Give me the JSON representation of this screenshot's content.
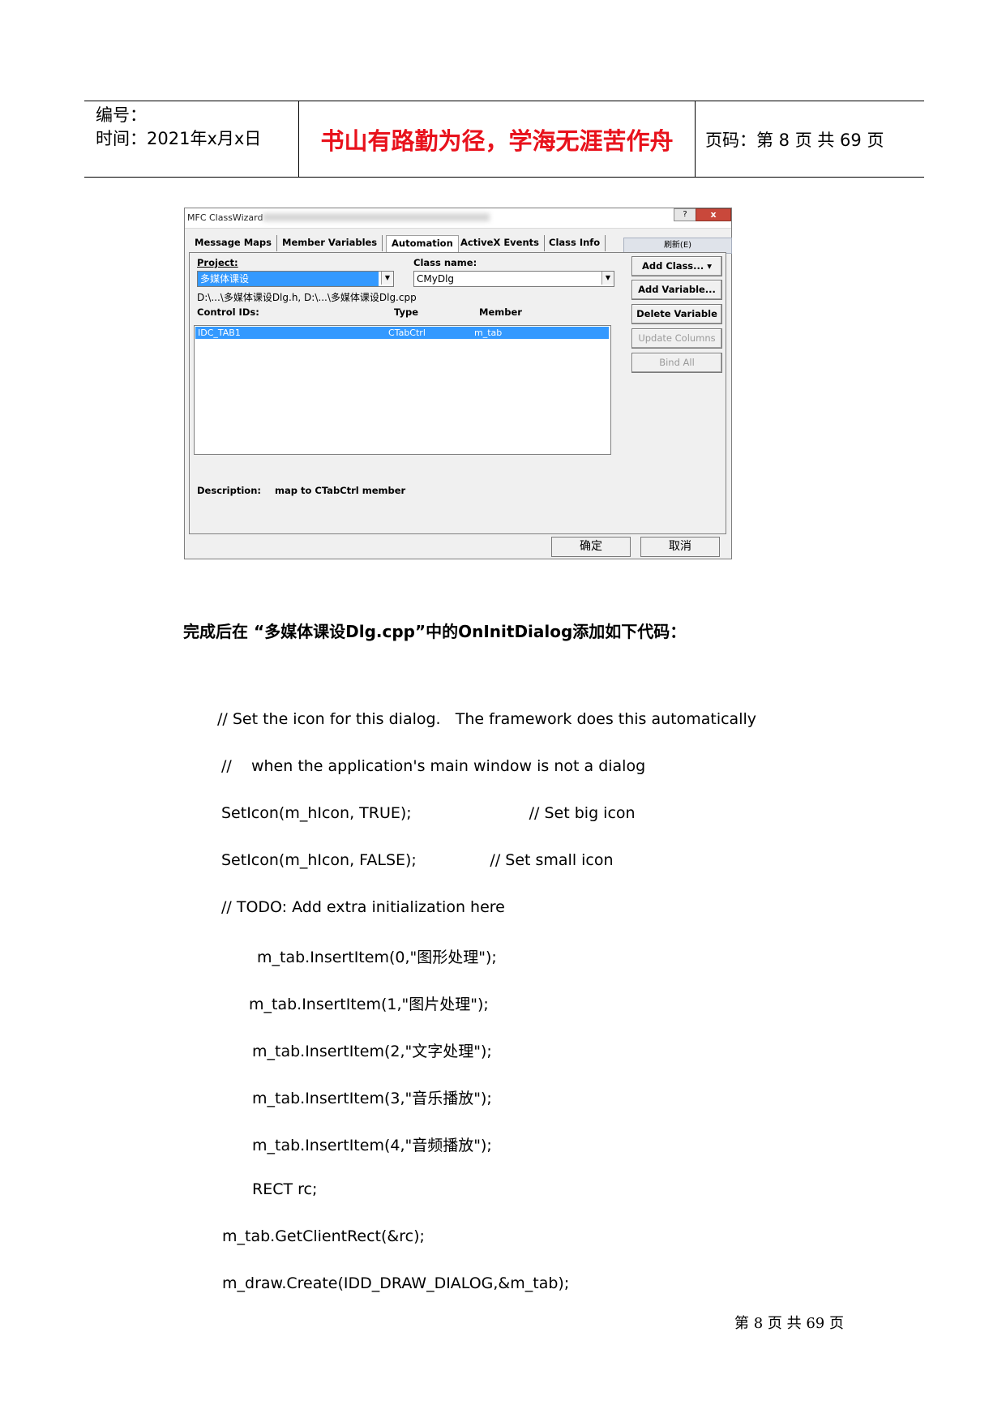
{
  "header": {
    "number_label": "编号：",
    "time_text": "时间：2021年x月x日",
    "motto": "书山有路勤为径，学海无涯苦作舟",
    "page_text": "页码：第 8 页  共 69 页"
  },
  "dialog": {
    "title": "MFC ClassWizard",
    "help_btn": "?",
    "close_btn": "x",
    "tabs": [
      "Message Maps",
      "Member Variables",
      "Automation",
      "ActiveX Events",
      "Class Info"
    ],
    "refresh_btn": "刷新(E)",
    "project_label": "Project:",
    "project_value": "多媒体课设",
    "class_label": "Class name:",
    "class_value": "CMyDlg",
    "file_path": "D:\\...\\多媒体课设Dlg.h, D:\\...\\多媒体课设Dlg.cpp",
    "col_headers": [
      "Control IDs:",
      "Type",
      "Member"
    ],
    "rows": [
      [
        "IDC_TAB1",
        "CTabCtrl",
        "m_tab"
      ]
    ],
    "buttons": [
      {
        "label": "Add Class...  ▾",
        "enabled": true
      },
      {
        "label": "Add Variable...",
        "enabled": true
      },
      {
        "label": "Delete Variable",
        "enabled": true
      },
      {
        "label": "Update Columns",
        "enabled": false
      },
      {
        "label": "Bind All",
        "enabled": false
      }
    ],
    "description_label": "Description:",
    "description_value": "map to CTabCtrl member",
    "ok_btn": "确定",
    "cancel_btn": "取消"
  },
  "body": {
    "heading": "完成后在 “多媒体课设Dlg.cpp”中的OnInitDialog添加如下代码：",
    "code_lines": [
      "// Set the icon for this dialog.   The framework does this automatically",
      "//    when the application's main window is not a dialog",
      "SetIcon(m_hIcon, TRUE);                        // Set big icon",
      "SetIcon(m_hIcon, FALSE);               // Set small icon",
      "// TODO: Add extra initialization here",
      "m_tab.InsertItem(0,\"图形处理\");",
      "m_tab.InsertItem(1,\"图片处理\");",
      "m_tab.InsertItem(2,\"文字处理\");",
      "m_tab.InsertItem(3,\"音乐播放\");",
      "m_tab.InsertItem(4,\"音频播放\");",
      "RECT rc;",
      "m_tab.GetClientRect(&rc);",
      "m_draw.Create(IDD_DRAW_DIALOG,&m_tab);"
    ]
  },
  "footer": {
    "page_text": "第 8 页 共 69 页"
  }
}
